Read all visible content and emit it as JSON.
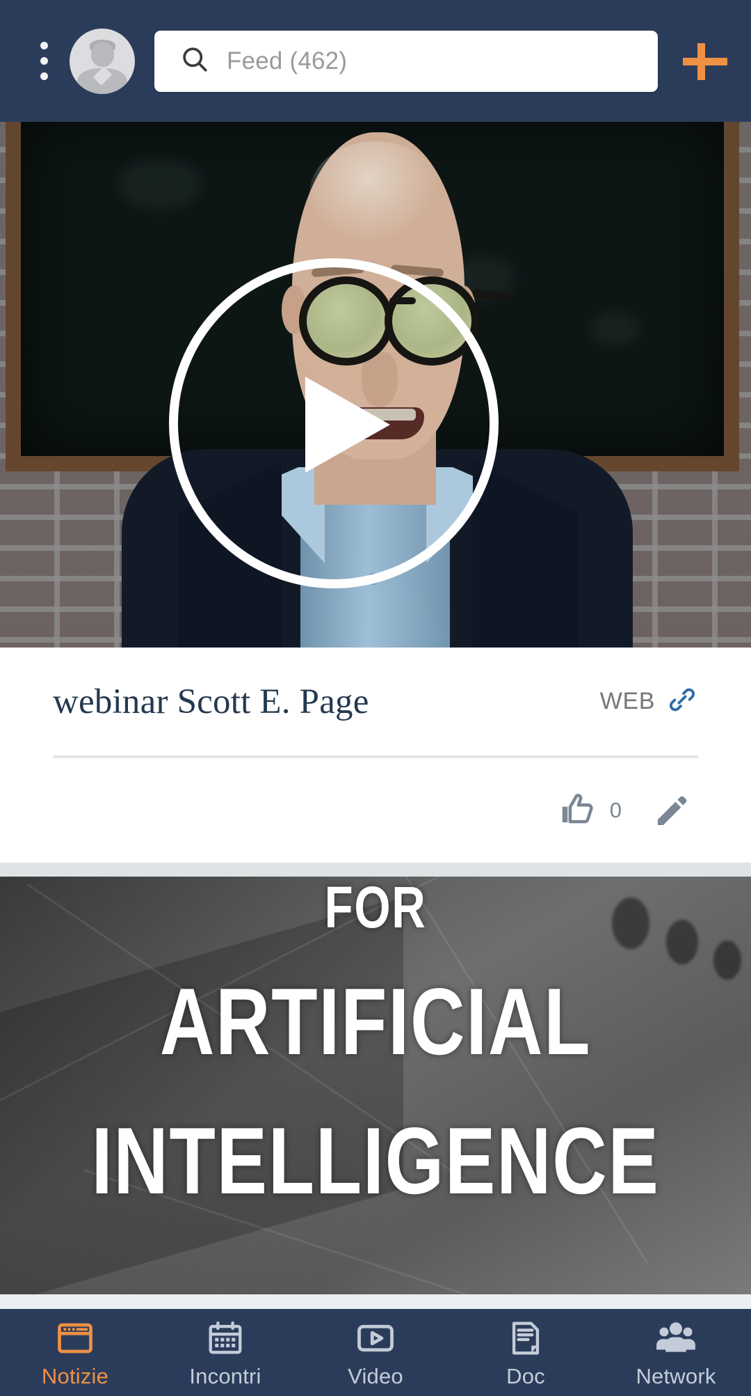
{
  "header": {
    "menu_icon": "kebab-menu-icon",
    "avatar_icon": "user-avatar-placeholder",
    "search": {
      "icon": "search-icon",
      "placeholder": "Feed (462)",
      "value": ""
    },
    "add_button_label": "+",
    "add_button_icon": "plus-icon",
    "background_color": "#2b3c5b",
    "accent_color": "#ef9043"
  },
  "feed": {
    "posts": [
      {
        "type": "video",
        "title": "webinar Scott E. Page",
        "source_label": "WEB",
        "source_icon": "link-icon",
        "play_icon": "play-button-icon",
        "like_icon": "thumbs-up-icon",
        "like_count": "0",
        "edit_icon": "pencil-edit-icon",
        "thumbnail_alt": "webinar speaker with glasses in front of brick wall"
      },
      {
        "type": "image",
        "image_text_lines": [
          "FOR",
          "ARTIFICIAL",
          "INTELLIGENCE"
        ],
        "thumbnail_alt": "grayscale industrial photo with large condensed white caption"
      }
    ]
  },
  "bottom_nav": {
    "items": [
      {
        "label": "Notizie",
        "icon": "browser-window-icon",
        "active": true
      },
      {
        "label": "Incontri",
        "icon": "calendar-icon",
        "active": false
      },
      {
        "label": "Video",
        "icon": "video-play-icon",
        "active": false
      },
      {
        "label": "Doc",
        "icon": "document-icon",
        "active": false
      },
      {
        "label": "Network",
        "icon": "people-group-icon",
        "active": false
      }
    ],
    "active_color": "#ef9043",
    "inactive_color": "#c3ccd8",
    "background_color": "#2b3c5b"
  }
}
